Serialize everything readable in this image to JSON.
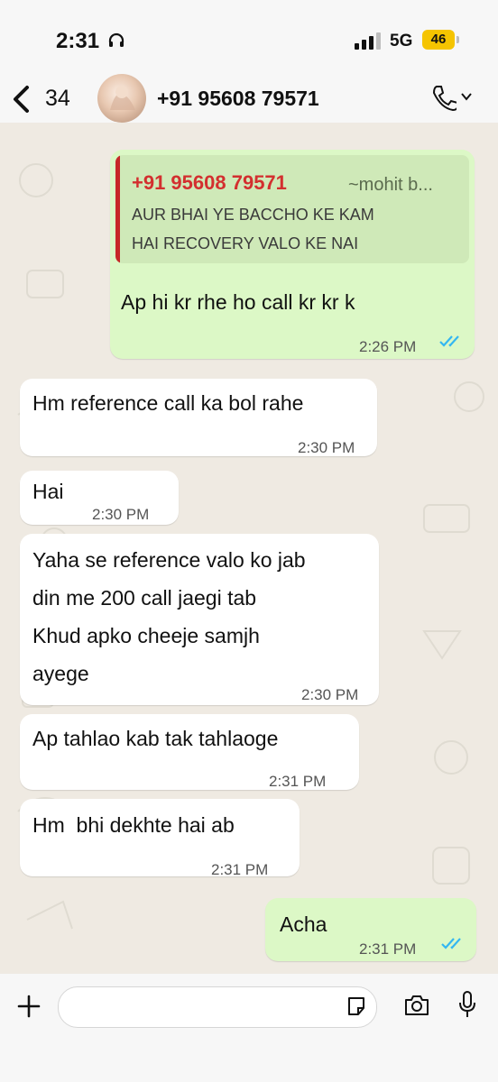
{
  "status_bar": {
    "time": "2:31",
    "network": "5G",
    "battery": "46"
  },
  "header": {
    "back_count": "34",
    "contact_name": "+91 95608 79571"
  },
  "messages": [
    {
      "direction": "outgoing",
      "quote": {
        "sender": "+91 95608 79571",
        "alias": "~mohit b...",
        "text": "AUR BHAI YE BACCHO KE KAM\nHAI RECOVERY VALO KE NAI"
      },
      "text": "Ap hi kr rhe ho call kr kr k",
      "time": "2:26 PM",
      "read": true
    },
    {
      "direction": "incoming",
      "text": "Hm reference call ka bol rahe",
      "time": "2:30 PM"
    },
    {
      "direction": "incoming",
      "text": "Hai",
      "time": "2:30 PM"
    },
    {
      "direction": "incoming",
      "text": "Yaha se reference valo ko jab\ndin me 200 call jaegi tab\nKhud apko cheeje samjh\nayege",
      "time": "2:30 PM"
    },
    {
      "direction": "incoming",
      "text": "Ap tahlao kab tak tahlaoge",
      "time": "2:31 PM"
    },
    {
      "direction": "incoming",
      "text": "Hm  bhi dekhte hai ab",
      "time": "2:31 PM"
    },
    {
      "direction": "outgoing",
      "text": "Acha",
      "time": "2:31 PM",
      "read": true
    }
  ],
  "input_bar": {
    "placeholder": ""
  },
  "colors": {
    "outgoing_bubble": "#dcf8c6",
    "incoming_bubble": "#ffffff",
    "quote_accent": "#c62828",
    "read_ticks": "#34b7f1"
  },
  "icons": [
    "headset-icon",
    "signal-icon",
    "back-chevron-icon",
    "phone-icon",
    "chevron-down-icon",
    "double-check-icon",
    "plus-icon",
    "sticker-icon",
    "camera-icon",
    "microphone-icon"
  ]
}
